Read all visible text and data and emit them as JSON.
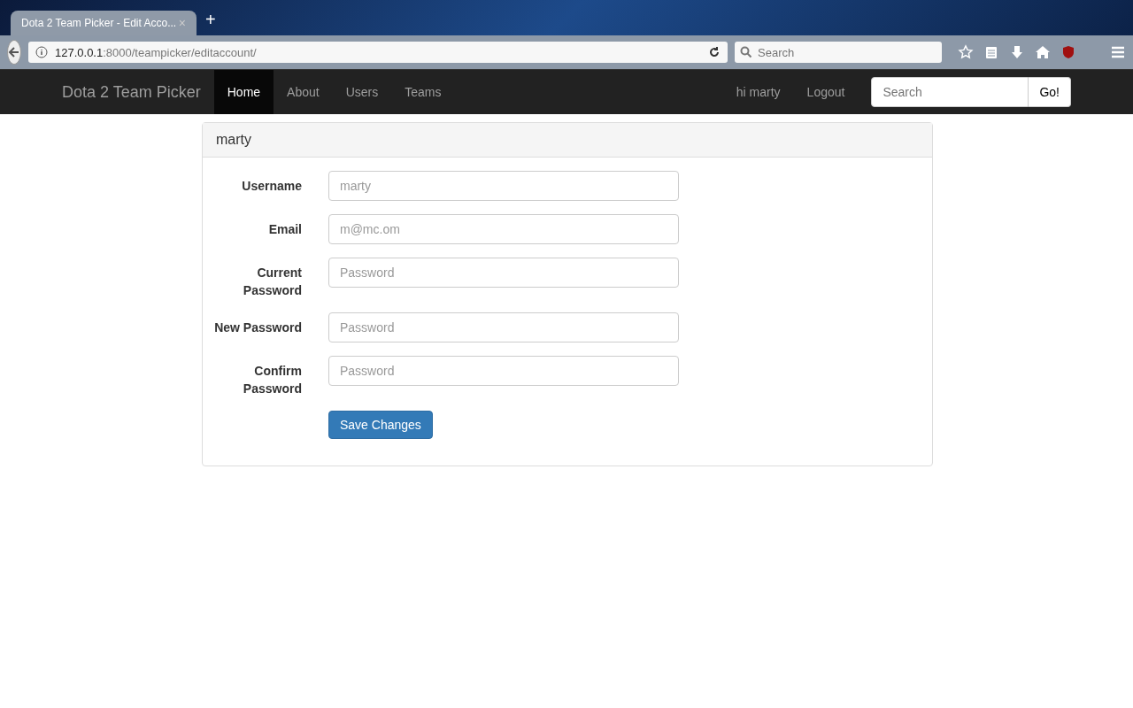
{
  "browser": {
    "tab": {
      "title": "Dota 2 Team Picker - Edit Acco...",
      "close": "×",
      "selected": true
    },
    "new_tab": "+",
    "url": {
      "host": "127.0.0.1",
      "rest": ":8000/teampicker/editaccount/"
    },
    "search": {
      "placeholder": "Search"
    }
  },
  "navbar": {
    "brand": "Dota 2 Team Picker",
    "items": [
      {
        "label": "Home",
        "selected": true
      },
      {
        "label": "About",
        "selected": false
      },
      {
        "label": "Users",
        "selected": false
      },
      {
        "label": "Teams",
        "selected": false
      }
    ],
    "right_items": [
      "hi marty",
      "Logout"
    ],
    "search": {
      "placeholder": "Search",
      "button": "Go!"
    }
  },
  "panel": {
    "title": "marty",
    "fields": [
      {
        "label": "Username",
        "placeholder": "marty"
      },
      {
        "label": "Email",
        "placeholder": "m@mc.om"
      },
      {
        "label": "Current Password",
        "placeholder": "Password"
      },
      {
        "label": "New Password",
        "placeholder": "Password"
      },
      {
        "label": "Confirm Password",
        "placeholder": "Password"
      }
    ],
    "button": "Save Changes"
  }
}
